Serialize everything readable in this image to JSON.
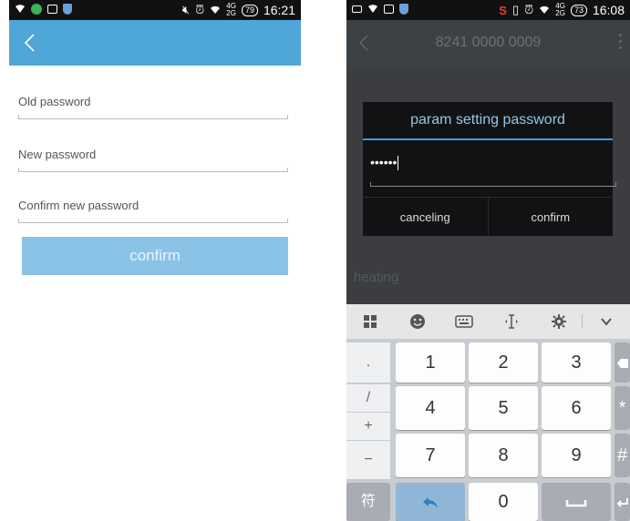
{
  "left": {
    "status_time": "16:21",
    "battery": "79",
    "signal_top": "4G",
    "signal_bottom": "2G",
    "fields": [
      {
        "label": "Old password"
      },
      {
        "label": "New password"
      },
      {
        "label": "Confirm new password"
      }
    ],
    "confirm_label": "confirm"
  },
  "right": {
    "status_time": "16:08",
    "battery": "73",
    "signal_top": "4G",
    "signal_bottom": "2G",
    "title": "8241 0000 0009",
    "background_label": "heating",
    "dialog": {
      "title": "param setting password",
      "masked_value": "••••••",
      "cancel_label": "canceling",
      "confirm_label": "confirm"
    },
    "toolbar": [
      "grid",
      "emoji",
      "keyboard",
      "cursor",
      "settings",
      "collapse"
    ],
    "side_keys": [
      ".",
      "/",
      "+",
      "−"
    ],
    "digits": [
      "1",
      "2",
      "3",
      "4",
      "5",
      "6",
      "7",
      "8",
      "9",
      "0"
    ],
    "symbols": {
      "star": "*",
      "hash": "#",
      "fu": "符"
    },
    "accent": "#3aa0d6"
  }
}
